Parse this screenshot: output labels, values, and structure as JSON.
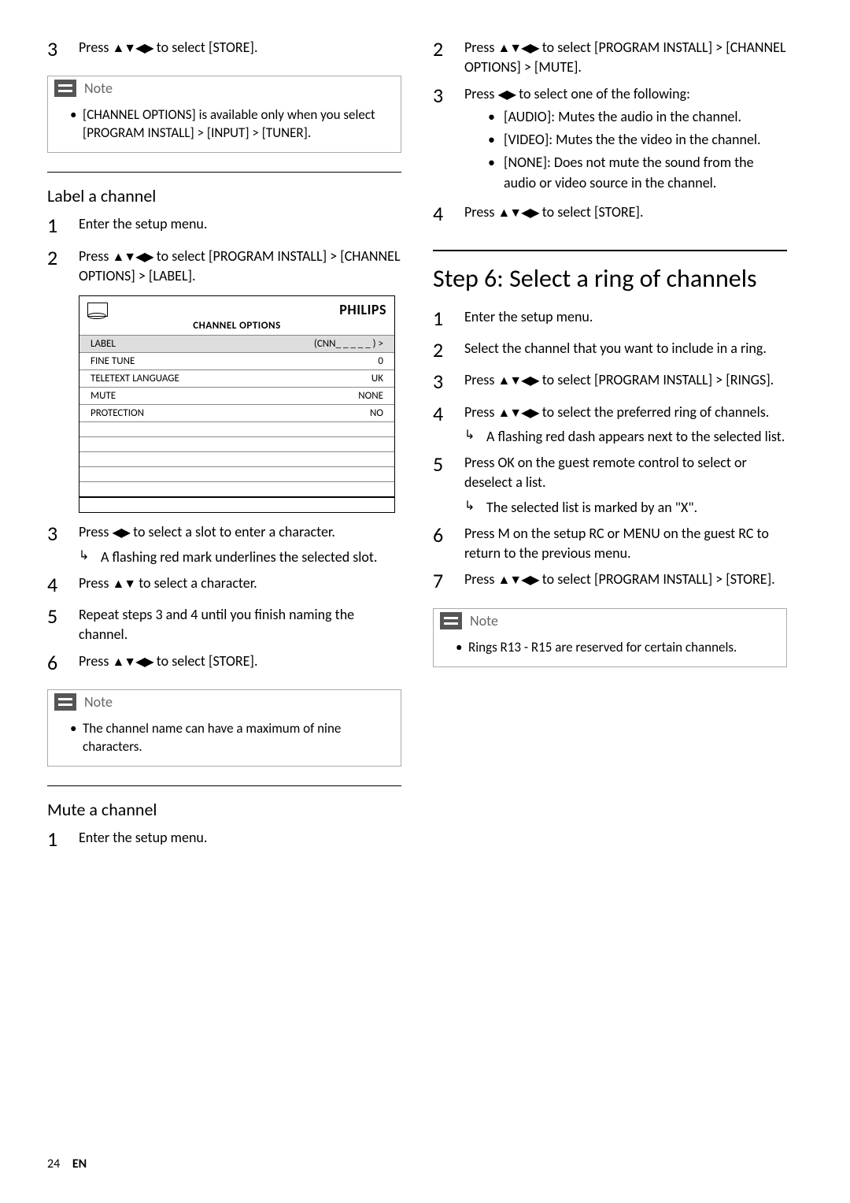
{
  "left": {
    "step3_text": "Press ",
    "step3_tail": " to select [STORE].",
    "note1_title": "Note",
    "note1_body": "[CHANNEL OPTIONS] is available only when you select [PROGRAM INSTALL] > [INPUT] > [TUNER].",
    "label_heading": "Label a channel",
    "lb_step1": "Enter the setup menu.",
    "lb_step2a": "Press ",
    "lb_step2b": " to select [PROGRAM INSTALL] > [CHANNEL OPTIONS] > [LABEL].",
    "tv_title": "CHANNEL OPTIONS",
    "tv_rows": [
      {
        "k": "LABEL",
        "v": "(CNN_ _ _ _ _ ) >"
      },
      {
        "k": "FINE TUNE",
        "v": "0"
      },
      {
        "k": "TELETEXT LANGUAGE",
        "v": "UK"
      },
      {
        "k": "MUTE",
        "v": "NONE"
      },
      {
        "k": "PROTECTION",
        "v": "NO"
      }
    ],
    "tv_logo": "PHILIPS",
    "lb_step3a": "Press ",
    "lb_step3b": " to select a slot to enter a character.",
    "lb_step3_sub": "A flashing red mark underlines the selected slot.",
    "lb_step4a": "Press ",
    "lb_step4b": " to select a character.",
    "lb_step5": "Repeat steps 3 and 4 until you finish naming the channel.",
    "lb_step6a": "Press ",
    "lb_step6b": " to select [STORE].",
    "note2_title": "Note",
    "note2_body": "The channel name can have a maximum of nine characters.",
    "mute_heading": "Mute a channel",
    "mute_step1": "Enter the setup menu."
  },
  "right": {
    "r_step2a": "Press ",
    "r_step2b": " to select [PROGRAM INSTALL] > [CHANNEL OPTIONS] > [MUTE].",
    "r_step3a": "Press ",
    "r_step3b": " to select one of the following:",
    "r_step3_opts": [
      {
        "k": "[AUDIO]",
        "v": ": Mutes the audio in the channel."
      },
      {
        "k": "[VIDEO]",
        "v": ": Mutes the the video in the channel."
      },
      {
        "k": "[NONE]",
        "v": ": Does not mute the sound from the audio or video source in the channel."
      }
    ],
    "r_step4a": "Press ",
    "r_step4b": " to select [STORE].",
    "ring_heading": "Step 6: Select a ring of channels",
    "ring1": "Enter the setup menu.",
    "ring2": "Select the channel that you want to include in a ring.",
    "ring3a": "Press ",
    "ring3b": " to select [PROGRAM INSTALL] > [RINGS].",
    "ring4a": "Press ",
    "ring4b": " to select the preferred ring of channels.",
    "ring4_sub": "A flashing red dash appears next to the selected list.",
    "ring5a": "Press OK on the guest remote control to select or deselect a list.",
    "ring5_sub": "The selected list is marked by an \"X\".",
    "ring6": "Press M on the setup RC or MENU on the guest RC to return to the previous menu.",
    "ring7a": "Press ",
    "ring7b": " to select [PROGRAM INSTALL] > [STORE].",
    "note3_title": "Note",
    "note3_body": "Rings R13 - R15 are reserved for certain channels."
  },
  "page_num": "24",
  "page_lang": "EN"
}
